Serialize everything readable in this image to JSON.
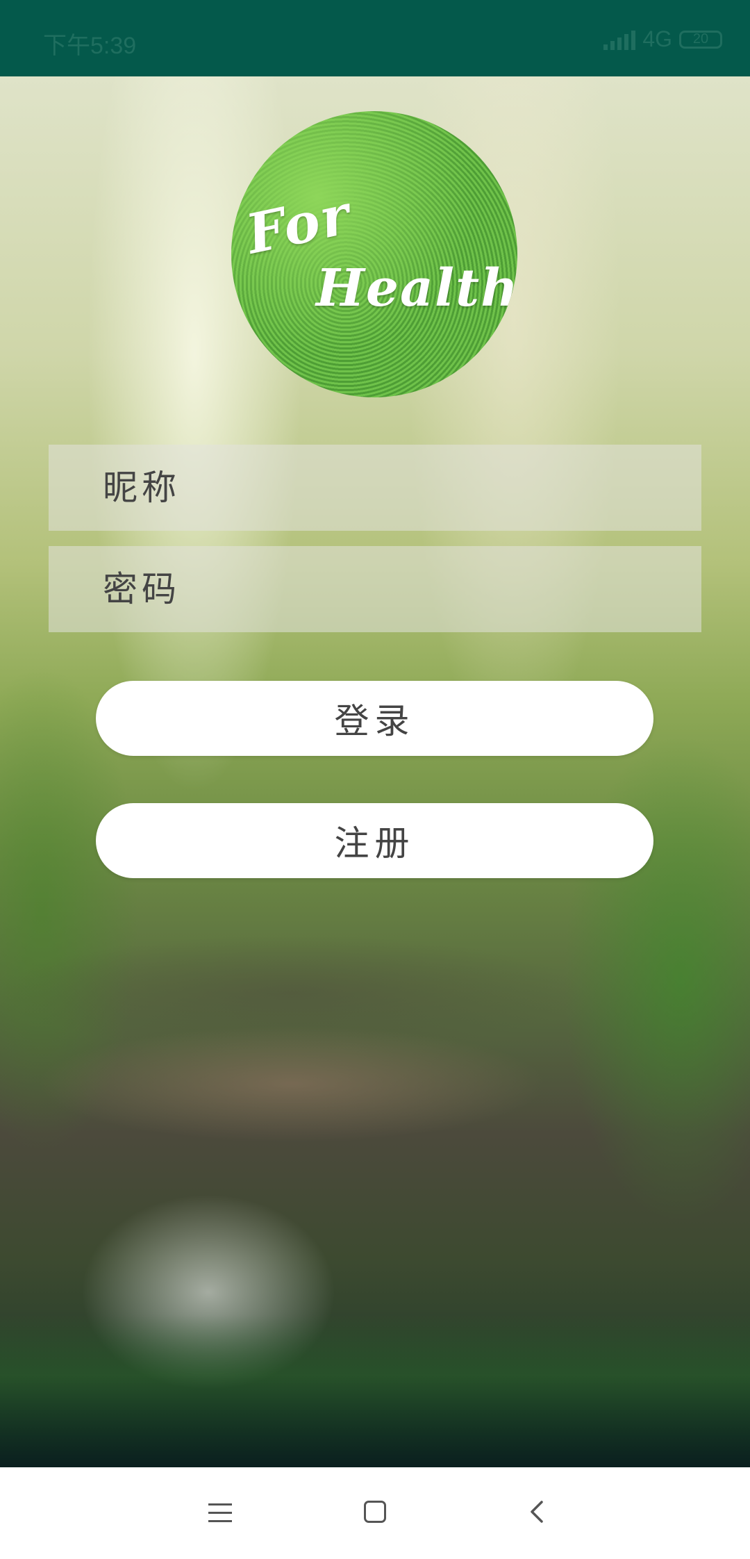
{
  "status_bar": {
    "time": "下午5:39",
    "network": "4G",
    "battery": "20"
  },
  "logo": {
    "line1": "For",
    "line2": "Health"
  },
  "form": {
    "nickname_placeholder": "昵称",
    "password_placeholder": "密码"
  },
  "buttons": {
    "login_label": "登录",
    "register_label": "注册"
  },
  "nav": {
    "icons": [
      "menu-icon",
      "home-icon",
      "back-icon"
    ]
  }
}
